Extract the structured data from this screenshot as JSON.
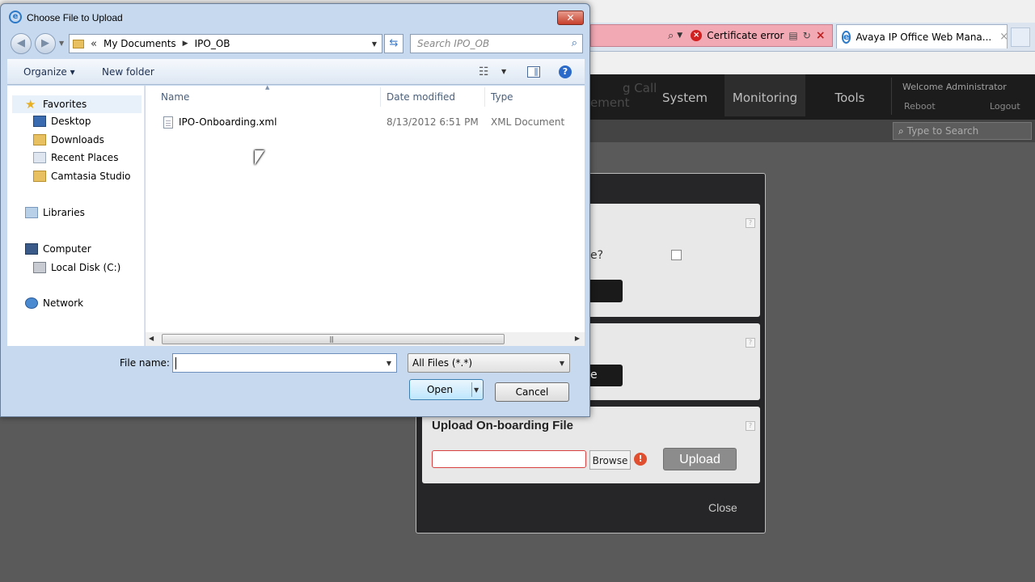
{
  "browser": {
    "tab_title": "Avaya IP Office Web Mana...",
    "cert_error": "Certificate error",
    "search_glyph": "⌕",
    "close_glyph": "×"
  },
  "app": {
    "nav_partial_1": "g Call",
    "nav_partial_2": "ement",
    "nav": [
      "System",
      "Monitoring",
      "Tools"
    ],
    "welcome": "Welcome Administrator",
    "reboot": "Reboot",
    "logout": "Logout",
    "search_placeholder": "Type to Search",
    "partial_question": "e?",
    "partial_button2": "e",
    "upload_title": "Upload On-boarding File",
    "browse_label": "Browse",
    "upload_label": "Upload",
    "close_label": "Close",
    "help_glyph": "?",
    "error_glyph": "!"
  },
  "dialog": {
    "title": "Choose File to Upload",
    "address": {
      "chevron": "«",
      "parts": [
        "My Documents",
        "IPO_OB"
      ]
    },
    "search_placeholder": "Search IPO_OB",
    "toolbar": {
      "organize": "Organize",
      "new_folder": "New folder"
    },
    "sidebar": {
      "favorites": "Favorites",
      "desktop": "Desktop",
      "downloads": "Downloads",
      "recent_places": "Recent Places",
      "camtasia": "Camtasia Studio",
      "libraries": "Libraries",
      "computer": "Computer",
      "local_disk": "Local Disk (C:)",
      "network": "Network"
    },
    "columns": [
      "Name",
      "Date modified",
      "Type"
    ],
    "files": [
      {
        "name": "IPO-Onboarding.xml",
        "date": "8/13/2012 6:51 PM",
        "type": "XML Document"
      }
    ],
    "filename_label": "File name:",
    "filename_value": "",
    "filetype_value": "All Files (*.*)",
    "open_label": "Open",
    "cancel_label": "Cancel"
  },
  "colors": {
    "modal_bg": "#262628",
    "upload_button": "#8c8c8c",
    "error_red": "#e05030",
    "open_button": "#bee6fd"
  },
  "icons": [
    "ie-icon",
    "close-icon",
    "back-icon",
    "forward-icon",
    "folder-icon",
    "refresh-icon",
    "search-icon",
    "views-icon",
    "preview-pane-icon",
    "help-icon",
    "star-icon",
    "desktop-icon",
    "downloads-icon",
    "recent-places-icon",
    "libraries-icon",
    "computer-icon",
    "local-disk-icon",
    "network-icon",
    "xml-file-icon",
    "mouse-pointer-icon"
  ]
}
